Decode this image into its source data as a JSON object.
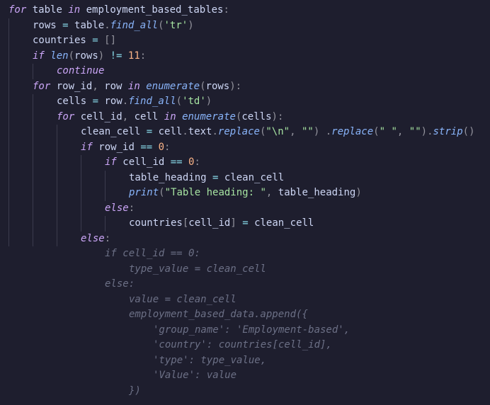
{
  "code": {
    "lines": [
      {
        "indent": 0,
        "tokens": [
          {
            "t": "kw",
            "v": "for"
          },
          {
            "t": "sp",
            "v": " "
          },
          {
            "t": "var",
            "v": "table"
          },
          {
            "t": "sp",
            "v": " "
          },
          {
            "t": "kw",
            "v": "in"
          },
          {
            "t": "sp",
            "v": " "
          },
          {
            "t": "var",
            "v": "employment_based_tables"
          },
          {
            "t": "punc",
            "v": ":"
          }
        ]
      },
      {
        "indent": 1,
        "tokens": [
          {
            "t": "var",
            "v": "rows"
          },
          {
            "t": "sp",
            "v": " "
          },
          {
            "t": "op",
            "v": "="
          },
          {
            "t": "sp",
            "v": " "
          },
          {
            "t": "var",
            "v": "table"
          },
          {
            "t": "punc",
            "v": "."
          },
          {
            "t": "fn",
            "v": "find_all"
          },
          {
            "t": "punc",
            "v": "("
          },
          {
            "t": "str",
            "v": "'tr'"
          },
          {
            "t": "punc",
            "v": ")"
          }
        ]
      },
      {
        "indent": 1,
        "tokens": [
          {
            "t": "var",
            "v": "countries"
          },
          {
            "t": "sp",
            "v": " "
          },
          {
            "t": "op",
            "v": "="
          },
          {
            "t": "sp",
            "v": " "
          },
          {
            "t": "punc",
            "v": "["
          },
          {
            "t": "punc",
            "v": "]"
          }
        ]
      },
      {
        "indent": 1,
        "tokens": [
          {
            "t": "kw",
            "v": "if"
          },
          {
            "t": "sp",
            "v": " "
          },
          {
            "t": "blt",
            "v": "len"
          },
          {
            "t": "punc",
            "v": "("
          },
          {
            "t": "var",
            "v": "rows"
          },
          {
            "t": "punc",
            "v": ")"
          },
          {
            "t": "sp",
            "v": " "
          },
          {
            "t": "op",
            "v": "!="
          },
          {
            "t": "sp",
            "v": " "
          },
          {
            "t": "num",
            "v": "11"
          },
          {
            "t": "punc",
            "v": ":"
          }
        ]
      },
      {
        "indent": 2,
        "tokens": [
          {
            "t": "kw",
            "v": "continue"
          }
        ]
      },
      {
        "indent": 1,
        "tokens": [
          {
            "t": "kw",
            "v": "for"
          },
          {
            "t": "sp",
            "v": " "
          },
          {
            "t": "var",
            "v": "row_id"
          },
          {
            "t": "punc",
            "v": ","
          },
          {
            "t": "sp",
            "v": " "
          },
          {
            "t": "var",
            "v": "row"
          },
          {
            "t": "sp",
            "v": " "
          },
          {
            "t": "kw",
            "v": "in"
          },
          {
            "t": "sp",
            "v": " "
          },
          {
            "t": "blt",
            "v": "enumerate"
          },
          {
            "t": "punc",
            "v": "("
          },
          {
            "t": "var",
            "v": "rows"
          },
          {
            "t": "punc",
            "v": ")"
          },
          {
            "t": "punc",
            "v": ":"
          }
        ]
      },
      {
        "indent": 2,
        "tokens": [
          {
            "t": "var",
            "v": "cells"
          },
          {
            "t": "sp",
            "v": " "
          },
          {
            "t": "op",
            "v": "="
          },
          {
            "t": "sp",
            "v": " "
          },
          {
            "t": "var",
            "v": "row"
          },
          {
            "t": "punc",
            "v": "."
          },
          {
            "t": "fn",
            "v": "find_all"
          },
          {
            "t": "punc",
            "v": "("
          },
          {
            "t": "str",
            "v": "'td'"
          },
          {
            "t": "punc",
            "v": ")"
          }
        ]
      },
      {
        "indent": 2,
        "tokens": [
          {
            "t": "kw",
            "v": "for"
          },
          {
            "t": "sp",
            "v": " "
          },
          {
            "t": "var",
            "v": "cell_id"
          },
          {
            "t": "punc",
            "v": ","
          },
          {
            "t": "sp",
            "v": " "
          },
          {
            "t": "var",
            "v": "cell"
          },
          {
            "t": "sp",
            "v": " "
          },
          {
            "t": "kw",
            "v": "in"
          },
          {
            "t": "sp",
            "v": " "
          },
          {
            "t": "blt",
            "v": "enumerate"
          },
          {
            "t": "punc",
            "v": "("
          },
          {
            "t": "var",
            "v": "cells"
          },
          {
            "t": "punc",
            "v": ")"
          },
          {
            "t": "punc",
            "v": ":"
          }
        ]
      },
      {
        "indent": 3,
        "tokens": [
          {
            "t": "var",
            "v": "clean_cell"
          },
          {
            "t": "sp",
            "v": " "
          },
          {
            "t": "op",
            "v": "="
          },
          {
            "t": "sp",
            "v": " "
          },
          {
            "t": "var",
            "v": "cell"
          },
          {
            "t": "punc",
            "v": "."
          },
          {
            "t": "var",
            "v": "text"
          },
          {
            "t": "punc",
            "v": "."
          },
          {
            "t": "fn",
            "v": "replace"
          },
          {
            "t": "punc",
            "v": "("
          },
          {
            "t": "str",
            "v": "\"\\n\""
          },
          {
            "t": "punc",
            "v": ","
          },
          {
            "t": "sp",
            "v": " "
          },
          {
            "t": "str",
            "v": "\"\""
          },
          {
            "t": "punc",
            "v": ")"
          },
          {
            "t": "sp",
            "v": " "
          },
          {
            "t": "punc",
            "v": "."
          },
          {
            "t": "fn",
            "v": "replace"
          },
          {
            "t": "punc",
            "v": "("
          },
          {
            "t": "str",
            "v": "\" \""
          },
          {
            "t": "punc",
            "v": ","
          },
          {
            "t": "sp",
            "v": " "
          },
          {
            "t": "str",
            "v": "\"\""
          },
          {
            "t": "punc",
            "v": ")"
          },
          {
            "t": "punc",
            "v": "."
          },
          {
            "t": "fn",
            "v": "strip"
          },
          {
            "t": "punc",
            "v": "("
          },
          {
            "t": "punc",
            "v": ")"
          }
        ]
      },
      {
        "indent": 3,
        "tokens": [
          {
            "t": "kw",
            "v": "if"
          },
          {
            "t": "sp",
            "v": " "
          },
          {
            "t": "var",
            "v": "row_id"
          },
          {
            "t": "sp",
            "v": " "
          },
          {
            "t": "op",
            "v": "=="
          },
          {
            "t": "sp",
            "v": " "
          },
          {
            "t": "num",
            "v": "0"
          },
          {
            "t": "punc",
            "v": ":"
          }
        ]
      },
      {
        "indent": 4,
        "tokens": [
          {
            "t": "kw",
            "v": "if"
          },
          {
            "t": "sp",
            "v": " "
          },
          {
            "t": "var",
            "v": "cell_id"
          },
          {
            "t": "sp",
            "v": " "
          },
          {
            "t": "op",
            "v": "=="
          },
          {
            "t": "sp",
            "v": " "
          },
          {
            "t": "num",
            "v": "0"
          },
          {
            "t": "punc",
            "v": ":"
          }
        ]
      },
      {
        "indent": 5,
        "tokens": [
          {
            "t": "var",
            "v": "table_heading"
          },
          {
            "t": "sp",
            "v": " "
          },
          {
            "t": "op",
            "v": "="
          },
          {
            "t": "sp",
            "v": " "
          },
          {
            "t": "var",
            "v": "clean_cell"
          }
        ]
      },
      {
        "indent": 5,
        "tokens": [
          {
            "t": "blt",
            "v": "print"
          },
          {
            "t": "punc",
            "v": "("
          },
          {
            "t": "str",
            "v": "\"Table heading: \""
          },
          {
            "t": "punc",
            "v": ","
          },
          {
            "t": "sp",
            "v": " "
          },
          {
            "t": "var",
            "v": "table_heading"
          },
          {
            "t": "punc",
            "v": ")"
          }
        ]
      },
      {
        "indent": 4,
        "tokens": [
          {
            "t": "kw",
            "v": "else"
          },
          {
            "t": "punc",
            "v": ":"
          }
        ]
      },
      {
        "indent": 5,
        "tokens": [
          {
            "t": "var",
            "v": "countries"
          },
          {
            "t": "punc",
            "v": "["
          },
          {
            "t": "var",
            "v": "cell_id"
          },
          {
            "t": "punc",
            "v": "]"
          },
          {
            "t": "sp",
            "v": " "
          },
          {
            "t": "op",
            "v": "="
          },
          {
            "t": "sp",
            "v": " "
          },
          {
            "t": "var",
            "v": "clean_cell"
          }
        ]
      },
      {
        "indent": 3,
        "tokens": [
          {
            "t": "kw",
            "v": "else"
          },
          {
            "t": "punc",
            "v": ":"
          }
        ]
      },
      {
        "indent": 4,
        "ghost": true,
        "tokens": [
          {
            "t": "cmt",
            "v": "if cell_id == 0:"
          }
        ]
      },
      {
        "indent": 5,
        "ghost": true,
        "tokens": [
          {
            "t": "cmt",
            "v": "type_value = clean_cell"
          }
        ]
      },
      {
        "indent": 4,
        "ghost": true,
        "tokens": [
          {
            "t": "cmt",
            "v": "else:"
          }
        ]
      },
      {
        "indent": 5,
        "ghost": true,
        "tokens": [
          {
            "t": "cmt",
            "v": "value = clean_cell"
          }
        ]
      },
      {
        "indent": 5,
        "ghost": true,
        "tokens": [
          {
            "t": "cmt",
            "v": "employment_based_data.append({"
          }
        ]
      },
      {
        "indent": 6,
        "ghost": true,
        "tokens": [
          {
            "t": "cmt",
            "v": "'group_name': 'Employment-based',"
          }
        ]
      },
      {
        "indent": 6,
        "ghost": true,
        "tokens": [
          {
            "t": "cmt",
            "v": "'country': countries[cell_id],"
          }
        ]
      },
      {
        "indent": 6,
        "ghost": true,
        "tokens": [
          {
            "t": "cmt",
            "v": "'type': type_value,"
          }
        ]
      },
      {
        "indent": 6,
        "ghost": true,
        "tokens": [
          {
            "t": "cmt",
            "v": "'Value': value"
          }
        ]
      },
      {
        "indent": 5,
        "ghost": true,
        "tokens": [
          {
            "t": "cmt",
            "v": "})"
          }
        ]
      }
    ]
  }
}
